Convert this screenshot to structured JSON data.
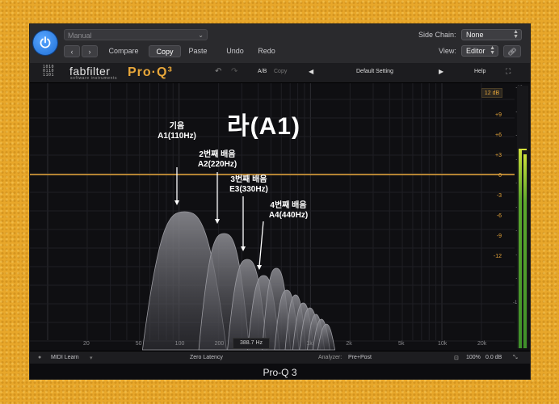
{
  "host": {
    "preset": "Manual",
    "compare": "Compare",
    "copy": "Copy",
    "paste": "Paste",
    "undo": "Undo",
    "redo": "Redo",
    "sidechain_label": "Side Chain:",
    "sidechain_value": "None",
    "view_label": "View:",
    "view_value": "Editor"
  },
  "plugin": {
    "brand": "fabfilter",
    "brand_sub": "software instruments",
    "product": "Pro·Q³",
    "ab": "A/B",
    "copy": "Copy",
    "preset": "Default Setting",
    "help": "Help",
    "range": "12 dB"
  },
  "overlay": {
    "title": "라(A1)",
    "notes": [
      {
        "line1": "기음",
        "line2": "A1(110Hz)"
      },
      {
        "line1": "2번째 배음",
        "line2": "A2(220Hz)"
      },
      {
        "line1": "3번째 배음",
        "line2": "E3(330Hz)"
      },
      {
        "line1": "4번째 배음",
        "line2": "A4(440Hz)"
      }
    ]
  },
  "eq_scale": [
    "+9",
    "+6",
    "+3",
    "0",
    "-3",
    "-6",
    "-9",
    "-12"
  ],
  "analyzer_scale": [
    "-10",
    "-20",
    "-30",
    "-40",
    "-50",
    "-60",
    "-70",
    "-80",
    "-90",
    "-100"
  ],
  "freq_labels": [
    "20",
    "50",
    "100",
    "200",
    "1k",
    "2k",
    "5k",
    "10k",
    "20k"
  ],
  "bottom": {
    "midi": "MIDI Learn",
    "latency": "Zero Latency",
    "freq_readout": "388.7 Hz",
    "analyzer_label": "Analyzer:",
    "analyzer_value": "Pre+Post",
    "zoom": "100%",
    "gain": "0.0 dB"
  },
  "caption": "Pro-Q 3",
  "colors": {
    "accent": "#e8a73a",
    "background": "#e9a92a",
    "power": "#2f86f0"
  }
}
